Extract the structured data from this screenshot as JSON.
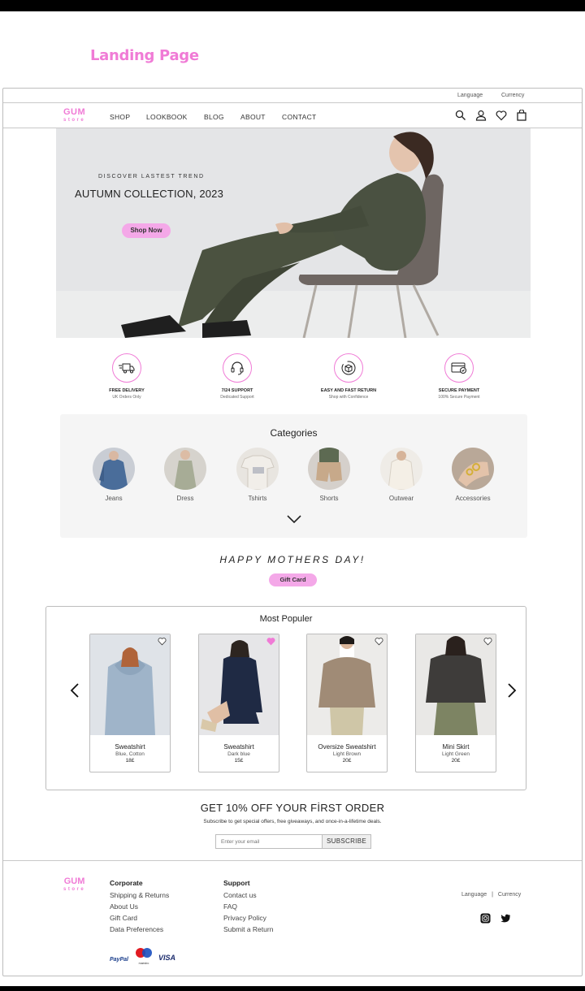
{
  "page_label": "Landing Page",
  "top_links": {
    "language": "Language",
    "currency": "Currency"
  },
  "logo": {
    "line1": "GUM",
    "line2": "store"
  },
  "nav": {
    "items": [
      "SHOP",
      "LOOKBOOK",
      "BLOG",
      "ABOUT",
      "CONTACT"
    ]
  },
  "hero": {
    "kicker": "DISCOVER LASTEST TREND",
    "title": "AUTUMN COLLECTION, 2023",
    "button": "Shop Now"
  },
  "features": [
    {
      "title": "FREE DELIVERY",
      "subtitle": "UK Orders Only",
      "icon": "truck-icon"
    },
    {
      "title": "7/24 SUPPORT",
      "subtitle": "Dedicated Support",
      "icon": "headset-icon"
    },
    {
      "title": "EASY AND FAST RETURN",
      "subtitle": "Shop with Confidence",
      "icon": "return-box-icon"
    },
    {
      "title": "SECURE PAYMENT",
      "subtitle": "100% Secure Payment",
      "icon": "secure-card-icon"
    }
  ],
  "categories": {
    "title": "Categories",
    "items": [
      "Jeans",
      "Dress",
      "Tshirts",
      "Shorts",
      "Outwear",
      "Accessories"
    ]
  },
  "promo_banner": {
    "title": "HAPPY MOTHERS DAY!",
    "button": "Gift Card"
  },
  "most_popular": {
    "title": "Most Populer",
    "products": [
      {
        "name": "Sweatshirt",
        "color": "Blue, Cotton",
        "price": "18£",
        "favorited": false
      },
      {
        "name": "Sweatshirt",
        "color": "Dark blue",
        "price": "15£",
        "favorited": true
      },
      {
        "name": "Oversize Sweatshirt",
        "color": "Light Brown",
        "price": "20£",
        "favorited": false
      },
      {
        "name": "Mini Skirt",
        "color": "Light Green",
        "price": "20£",
        "favorited": false
      }
    ]
  },
  "newsletter": {
    "title": "GET 10% OFF YOUR FİRST ORDER",
    "subtitle": "Subscribe to get special offers, free giveaways, and once-in-a-lifetime deals.",
    "placeholder": "Enter your email",
    "button": "SUBSCRIBE"
  },
  "footer": {
    "corporate": {
      "heading": "Corporate",
      "links": [
        "Shipping & Returns",
        "About Us",
        "Gift Card",
        "Data Preferences"
      ]
    },
    "support": {
      "heading": "Support",
      "links": [
        "Contact us",
        "FAQ",
        "Privacy Policy",
        "Submit a Return"
      ]
    },
    "settings": {
      "language": "Language",
      "separator": "|",
      "currency": "Currency"
    },
    "payments": {
      "paypal": "PayPal",
      "mastercard": "maestro",
      "visa": "VISA"
    }
  },
  "colors": {
    "accent": "#f07bd6",
    "button": "#f4a8e8"
  }
}
